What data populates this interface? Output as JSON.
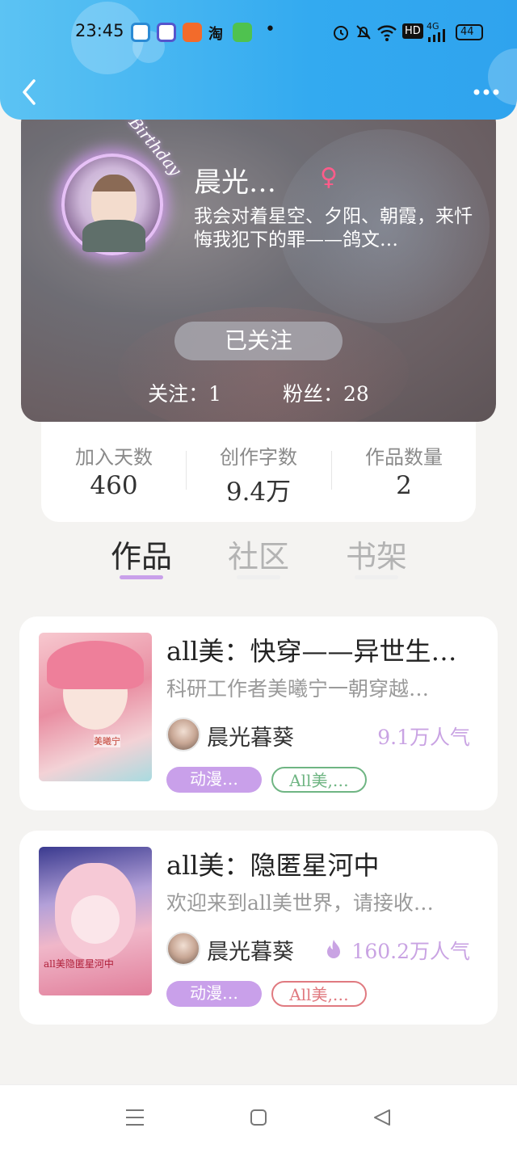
{
  "status_bar": {
    "time": "23:45",
    "app_icons": [
      "app-icon-1",
      "app-icon-2",
      "app-icon-3",
      "taobao-icon",
      "app-icon-5"
    ],
    "dot": "•",
    "network_label": "HD",
    "signal_label": "4G",
    "battery": "44"
  },
  "nav": {
    "back_icon": "chevron-left-icon",
    "more_icon": "more-dots-icon"
  },
  "profile": {
    "username": "晨光…",
    "gender_symbol": "♀",
    "bio": "我会对着星空、夕阳、朝霞，来忏悔我犯下的罪——鸽文…",
    "avatar_frame_text": "7Birthday",
    "follow_button": "已关注",
    "following": "关注：1",
    "followers": "粉丝：28"
  },
  "stats": [
    {
      "label": "加入天数",
      "value": "460"
    },
    {
      "label": "创作字数",
      "value": "9.4万"
    },
    {
      "label": "作品数量",
      "value": "2"
    }
  ],
  "tabs": [
    {
      "label": "作品",
      "active": true
    },
    {
      "label": "社区",
      "active": false
    },
    {
      "label": "书架",
      "active": false
    }
  ],
  "works": [
    {
      "title": "all美：快穿——异世生…",
      "description": "科研工作者美曦宁一朝穿越…",
      "author": "晨光暮葵",
      "popularity": "9.1万人气",
      "hot_icon": false,
      "tags": [
        "动漫…",
        "All美,…"
      ],
      "tag_outline_color": "#6fb583",
      "cover_caption": "美曦宁"
    },
    {
      "title": "all美：隐匿星河中",
      "description": "欢迎来到all美世界，请接收…",
      "author": "晨光暮葵",
      "popularity": "160.2万人气",
      "hot_icon": true,
      "tags": [
        "动漫…",
        "All美,…"
      ],
      "tag_outline_color": "#e07a80",
      "cover_caption": "all美隐匿星河中"
    }
  ],
  "colors": {
    "accent": "#c9a0ea",
    "header": "#33aaf0"
  },
  "bottom_nav": [
    "menu-icon",
    "home-square-icon",
    "back-triangle-icon"
  ]
}
